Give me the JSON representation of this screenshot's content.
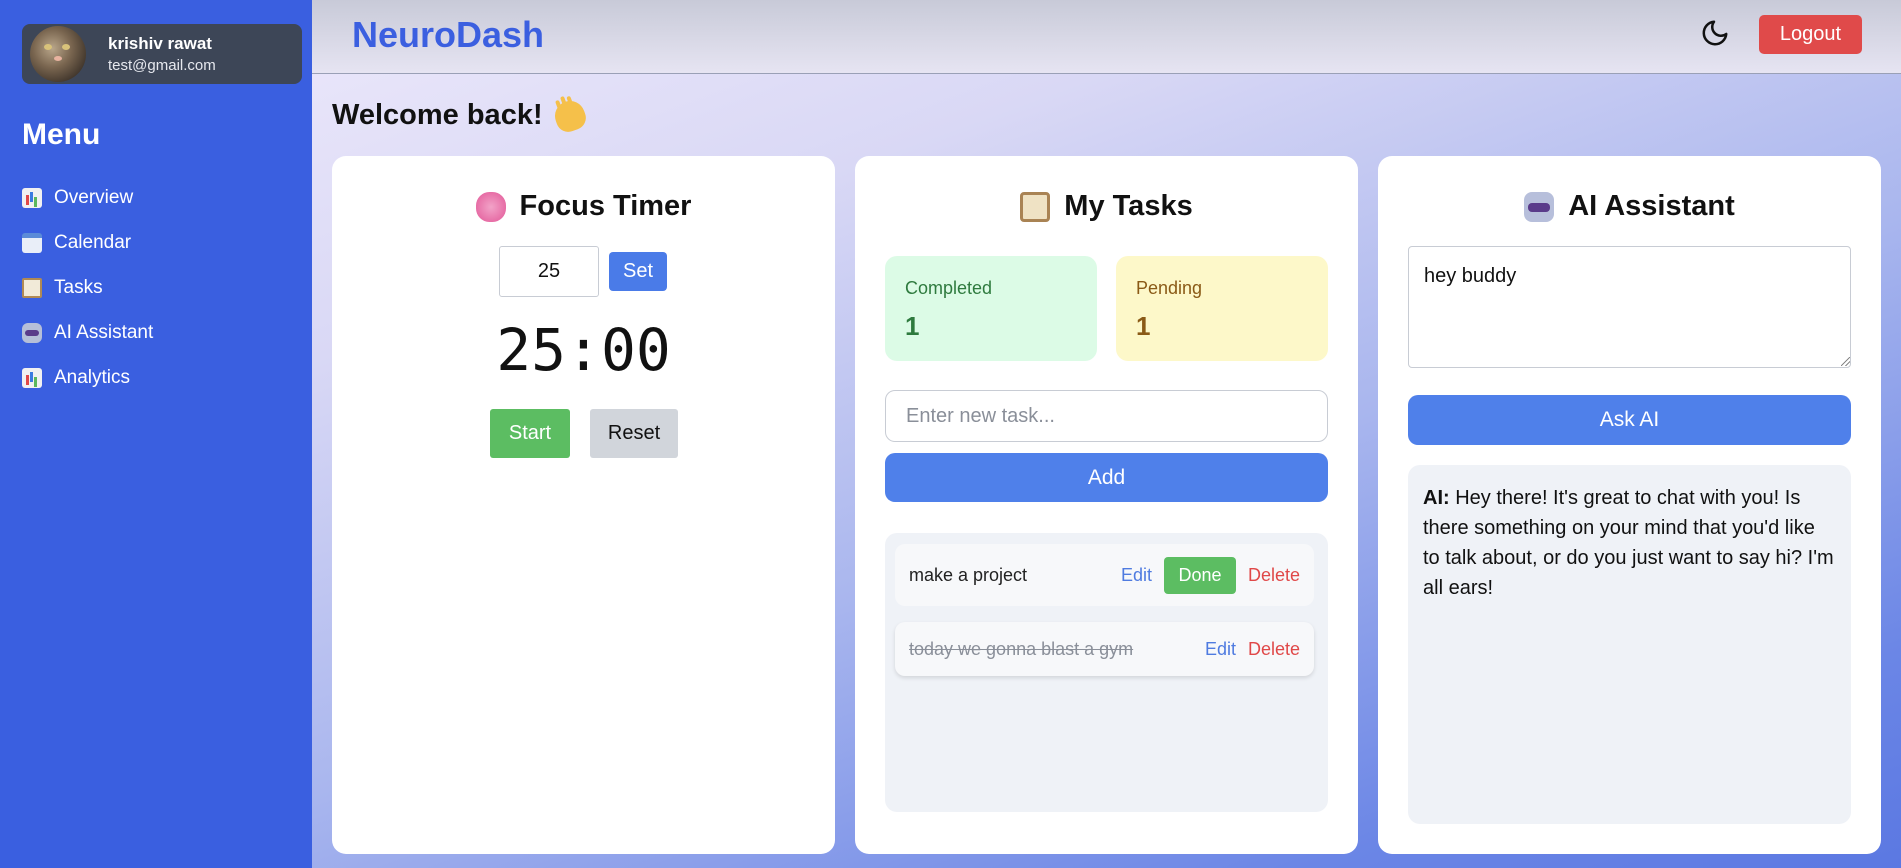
{
  "user": {
    "name": "krishiv rawat",
    "email": "test@gmail.com"
  },
  "sidebar": {
    "menu_title": "Menu",
    "items": [
      {
        "label": "Overview",
        "icon": "bar-chart-icon"
      },
      {
        "label": "Calendar",
        "icon": "calendar-icon"
      },
      {
        "label": "Tasks",
        "icon": "clipboard-icon"
      },
      {
        "label": "AI Assistant",
        "icon": "robot-icon"
      },
      {
        "label": "Analytics",
        "icon": "bar-chart-icon"
      }
    ]
  },
  "header": {
    "brand": "NeuroDash",
    "logout_label": "Logout",
    "theme_icon": "moon-icon"
  },
  "welcome": "Welcome back!",
  "timer": {
    "title": "Focus Timer",
    "minutes_value": "25",
    "set_label": "Set",
    "display": "25:00",
    "start_label": "Start",
    "reset_label": "Reset"
  },
  "tasks": {
    "title": "My Tasks",
    "completed_label": "Completed",
    "completed_count": "1",
    "pending_label": "Pending",
    "pending_count": "1",
    "input_placeholder": "Enter new task...",
    "add_label": "Add",
    "edit_label": "Edit",
    "done_label": "Done",
    "delete_label": "Delete",
    "items": [
      {
        "text": "make a project",
        "completed": false
      },
      {
        "text": "today we gonna blast a gym",
        "completed": true
      }
    ]
  },
  "ai": {
    "title": "AI Assistant",
    "prompt_value": "hey buddy",
    "ask_label": "Ask AI",
    "response_prefix": "AI:",
    "response_text": "Hey there! It's great to chat with you! Is there something on your mind that you'd like to talk about, or do you just want to say hi? I'm all ears!"
  },
  "colors": {
    "sidebar": "#3a5fe0",
    "brand": "#3b5fe0",
    "logout": "#e04a4a",
    "primary_button": "#4f80ea",
    "success": "#5cbd62",
    "danger": "#e04848"
  }
}
